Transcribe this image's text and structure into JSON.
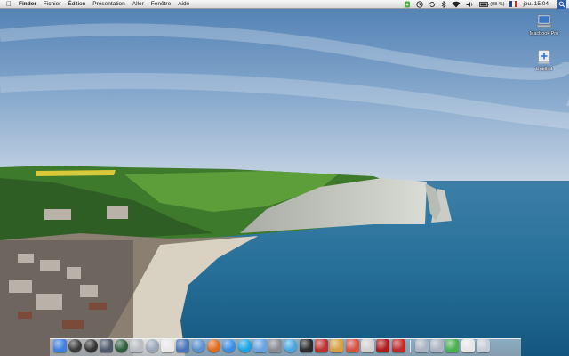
{
  "menubar": {
    "apple_icon": "apple-logo-icon",
    "menus": [
      {
        "label": "Finder",
        "bold": true
      },
      {
        "label": "Fichier"
      },
      {
        "label": "Édition"
      },
      {
        "label": "Présentation"
      },
      {
        "label": "Aller"
      },
      {
        "label": "Fenêtre"
      },
      {
        "label": "Aide"
      }
    ],
    "status_icons": [
      "evernote-icon",
      "time-machine-icon",
      "sync-icon",
      "bluetooth-icon",
      "wifi-icon",
      "volume-icon"
    ],
    "battery_label": "(98 %)",
    "flag_icon": "flag-icon",
    "clock": "jeu. 15:04",
    "spotlight_icon": "spotlight-search-icon"
  },
  "desktop_icons": [
    {
      "label": "Macbook Pro",
      "icon": "laptop-hd-icon"
    },
    {
      "label": "Untitled",
      "icon": "disk-image-icon"
    }
  ],
  "dock": {
    "apps": [
      {
        "name": "finder",
        "color": "#3f7fe0"
      },
      {
        "name": "dashboard",
        "color": "#3a3a3a"
      },
      {
        "name": "safari-compass",
        "color": "#333333"
      },
      {
        "name": "expose",
        "color": "#4d5a6b"
      },
      {
        "name": "time-machine",
        "color": "#2e5e3e"
      },
      {
        "name": "preview",
        "color": "#b8bcc4"
      },
      {
        "name": "app-store",
        "color": "#9aa6b6"
      },
      {
        "name": "itunes",
        "color": "#e8e8e8"
      },
      {
        "name": "iphoto",
        "color": "#4a74b8"
      },
      {
        "name": "safari",
        "color": "#5a8fd0"
      },
      {
        "name": "firefox",
        "color": "#e26b1c"
      },
      {
        "name": "messenger",
        "color": "#3a8de0"
      },
      {
        "name": "skype",
        "color": "#1aa6e6"
      },
      {
        "name": "chat",
        "color": "#6aa3df"
      },
      {
        "name": "system-preferences",
        "color": "#8a8d95"
      },
      {
        "name": "sync",
        "color": "#4aa6e0"
      },
      {
        "name": "terminal",
        "color": "#2a2a2a"
      },
      {
        "name": "photo-booth",
        "color": "#c03030"
      },
      {
        "name": "garageband",
        "color": "#d8a040"
      },
      {
        "name": "ical",
        "color": "#d85040"
      },
      {
        "name": "textedit",
        "color": "#d0d0d0"
      },
      {
        "name": "acrobat",
        "color": "#b01a1a"
      },
      {
        "name": "transmission",
        "color": "#c02a2a"
      }
    ],
    "stacks": [
      {
        "name": "applications-folder",
        "color": "#aab4c2"
      },
      {
        "name": "documents-folder",
        "color": "#aab4c2"
      },
      {
        "name": "downloads-folder",
        "color": "#4caf50"
      },
      {
        "name": "document-stack",
        "color": "#e6e6e6"
      },
      {
        "name": "trash",
        "color": "#c4ccd6"
      }
    ]
  }
}
